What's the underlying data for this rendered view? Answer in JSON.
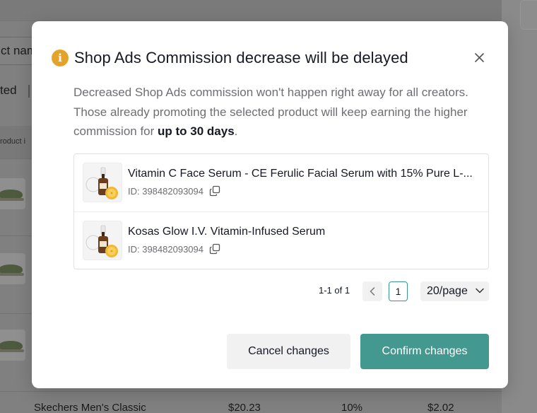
{
  "background": {
    "search_placeholder": "ct nam",
    "selected_label": "ted",
    "column_header": "roduct i",
    "bottom_row": {
      "name": "Skechers Men's Classic",
      "price": "$20.23",
      "commission": "10%",
      "earnings": "$2.02"
    }
  },
  "modal": {
    "title": "Shop Ads Commission decrease will be delayed",
    "info_icon": "info-icon",
    "close_icon": "close-icon",
    "description_prefix": "Decreased Shop Ads commission won't happen right away for all creators. Those already promoting the selected product will keep earning the higher commission for ",
    "description_emphasis": "up to 30 days",
    "description_suffix": ".",
    "products": [
      {
        "name": "Vitamin C Face Serum - CE Ferulic Facial Serum with 15% Pure L-...",
        "id_label": "ID: 398482093094"
      },
      {
        "name": "Kosas Glow I.V. Vitamin-Infused Serum",
        "id_label": "ID: 398482093094"
      }
    ],
    "pagination": {
      "range": "1-1 of 1",
      "current_page": "1",
      "page_size": "20/page"
    },
    "buttons": {
      "cancel": "Cancel changes",
      "confirm": "Confirm changes"
    }
  },
  "colors": {
    "accent": "#43988f",
    "info": "#e4a32a",
    "overlay": "#808080"
  }
}
